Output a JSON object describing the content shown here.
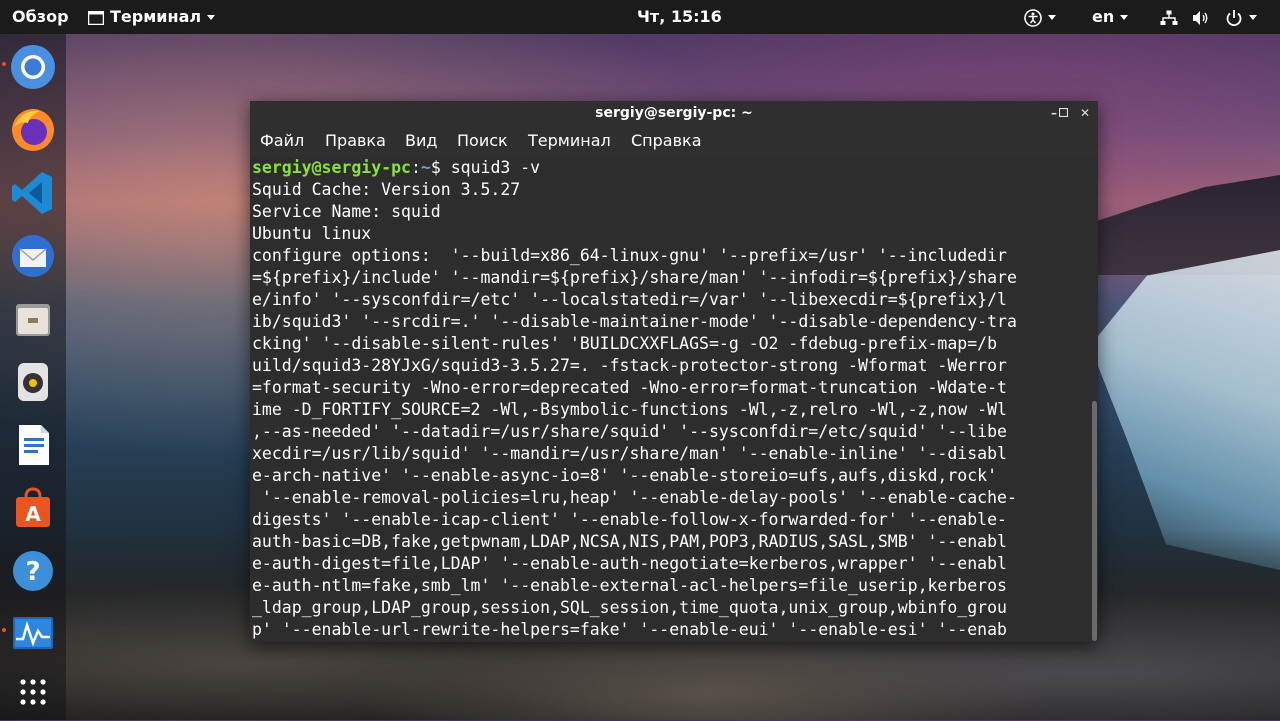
{
  "topbar": {
    "activities": "Обзор",
    "app_menu": "Терминал",
    "clock": "Чт, 15:16",
    "keyboard_layout": "en"
  },
  "dock": {
    "apps": [
      "chromium-icon",
      "firefox-icon",
      "vscode-icon",
      "thunderbird-icon",
      "files-icon",
      "rhythmbox-icon",
      "libreoffice-writer-icon",
      "ubuntu-software-icon",
      "help-icon",
      "system-monitor-icon",
      "show-applications-icon"
    ]
  },
  "window": {
    "title": "sergiy@sergiy-pc: ~",
    "menu": [
      "Файл",
      "Правка",
      "Вид",
      "Поиск",
      "Терминал",
      "Справка"
    ]
  },
  "terminal": {
    "prompt_user": "sergiy@sergiy-pc",
    "prompt_sep": ":",
    "prompt_path": "~",
    "prompt_symbol": "$ ",
    "command": "squid3 -v",
    "output": [
      "Squid Cache: Version 3.5.27",
      "Service Name: squid",
      "Ubuntu linux",
      "configure options:  '--build=x86_64-linux-gnu' '--prefix=/usr' '--includedir",
      "=${prefix}/include' '--mandir=${prefix}/share/man' '--infodir=${prefix}/share",
      "e/info' '--sysconfdir=/etc' '--localstatedir=/var' '--libexecdir=${prefix}/l",
      "ib/squid3' '--srcdir=.' '--disable-maintainer-mode' '--disable-dependency-tra",
      "cking' '--disable-silent-rules' 'BUILDCXXFLAGS=-g -O2 -fdebug-prefix-map=/b",
      "uild/squid3-28YJxG/squid3-3.5.27=. -fstack-protector-strong -Wformat -Werror",
      "=format-security -Wno-error=deprecated -Wno-error=format-truncation -Wdate-t",
      "ime -D_FORTIFY_SOURCE=2 -Wl,-Bsymbolic-functions -Wl,-z,relro -Wl,-z,now -Wl",
      ",--as-needed' '--datadir=/usr/share/squid' '--sysconfdir=/etc/squid' '--libe",
      "xecdir=/usr/lib/squid' '--mandir=/usr/share/man' '--enable-inline' '--disabl",
      "e-arch-native' '--enable-async-io=8' '--enable-storeio=ufs,aufs,diskd,rock'",
      " '--enable-removal-policies=lru,heap' '--enable-delay-pools' '--enable-cache-",
      "digests' '--enable-icap-client' '--enable-follow-x-forwarded-for' '--enable-",
      "auth-basic=DB,fake,getpwnam,LDAP,NCSA,NIS,PAM,POP3,RADIUS,SASL,SMB' '--enabl",
      "e-auth-digest=file,LDAP' '--enable-auth-negotiate=kerberos,wrapper' '--enabl",
      "e-auth-ntlm=fake,smb_lm' '--enable-external-acl-helpers=file_userip,kerberos",
      "_ldap_group,LDAP_group,session,SQL_session,time_quota,unix_group,wbinfo_grou",
      "p' '--enable-url-rewrite-helpers=fake' '--enable-eui' '--enable-esi' '--enab"
    ]
  },
  "colors": {
    "prompt_user": "#8ae234",
    "prompt_path": "#729fcf",
    "terminal_bg": "#2d2d2d",
    "accent": "#e95420"
  }
}
